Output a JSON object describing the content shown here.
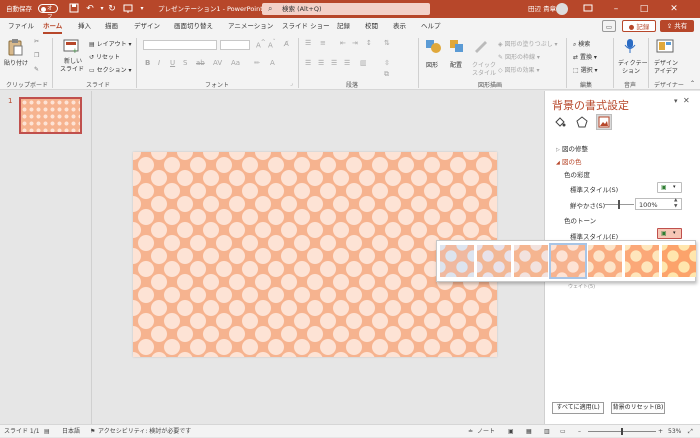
{
  "titlebar": {
    "autosave": "自動保存",
    "toggle_state": "オフ",
    "doc_title": "プレゼンテーション1 - PowerPoint",
    "search_placeholder": "検索 (Alt+Q)",
    "user_name": "田辺 貴章"
  },
  "tabs": [
    {
      "label": "ファイル"
    },
    {
      "label": "ホーム",
      "active": true
    },
    {
      "label": "挿入"
    },
    {
      "label": "描画"
    },
    {
      "label": "デザイン"
    },
    {
      "label": "画面切り替え"
    },
    {
      "label": "アニメーション"
    },
    {
      "label": "スライド ショー"
    },
    {
      "label": "記録"
    },
    {
      "label": "校閲"
    },
    {
      "label": "表示"
    },
    {
      "label": "ヘルプ"
    }
  ],
  "tab_right": {
    "record": "記録",
    "share": "共有"
  },
  "ribbon": {
    "clipboard": {
      "paste": "貼り付け",
      "group": "クリップボード"
    },
    "slides": {
      "new_slide_1": "新しい",
      "new_slide_2": "スライド",
      "layout": "レイアウト",
      "reset": "リセット",
      "section": "セクション",
      "group": "スライド"
    },
    "font": {
      "group": "フォント"
    },
    "paragraph": {
      "group": "段落"
    },
    "drawing": {
      "shape": "図形",
      "arrange": "配置",
      "quick_style_1": "クイック",
      "quick_style_2": "スタイル",
      "fill": "図形の塗りつぶし",
      "outline": "図形の枠線",
      "effects": "図形の効果",
      "group": "図形描画"
    },
    "editing": {
      "find": "検索",
      "replace": "置換",
      "select": "選択",
      "group": "編集"
    },
    "voice": {
      "dictate_1": "ディクテー",
      "dictate_2": "ション",
      "group": "音声"
    },
    "designer": {
      "label_1": "デザイン",
      "label_2": "アイデア",
      "group": "デザイナー"
    }
  },
  "thumbnail": {
    "number": "1"
  },
  "format_pane": {
    "title": "背景の書式設定",
    "picture_correction": "図の修整",
    "picture_color": "図の色",
    "saturation": "色の彩度",
    "presets_s": "標準スタイル(S)",
    "saturation_label": "鮮やかさ(S)",
    "saturation_value": "100%",
    "tone": "色のトーン",
    "presets_e": "標準スタイル(E)",
    "tooltip_partial": "ウェイト(5)",
    "apply_all": "すべてに適用(L)",
    "reset_bg": "背景のリセット(B)"
  },
  "gallery": {
    "swatches": [
      {
        "bg": "#f0b9a0",
        "dot": "#dde4ef"
      },
      {
        "bg": "#f2b795",
        "dot": "#e8e2ea"
      },
      {
        "bg": "#f5b590",
        "dot": "#f2e2de"
      },
      {
        "bg": "#f6b38f",
        "dot": "#fde3d5",
        "selected": true
      },
      {
        "bg": "#f9ad82",
        "dot": "#fde4c9"
      },
      {
        "bg": "#fba878",
        "dot": "#fee6bc"
      },
      {
        "bg": "#fca36b",
        "dot": "#ffe6ad"
      }
    ]
  },
  "status": {
    "slide": "スライド 1/1",
    "language": "日本語",
    "accessibility": "アクセシビリティ: 検討が必要です",
    "notes": "ノート",
    "zoom": "53%"
  },
  "colors": {
    "accent": "#b7472a",
    "slide_bg": "#f6b38f",
    "dots": "#fde3d5"
  }
}
